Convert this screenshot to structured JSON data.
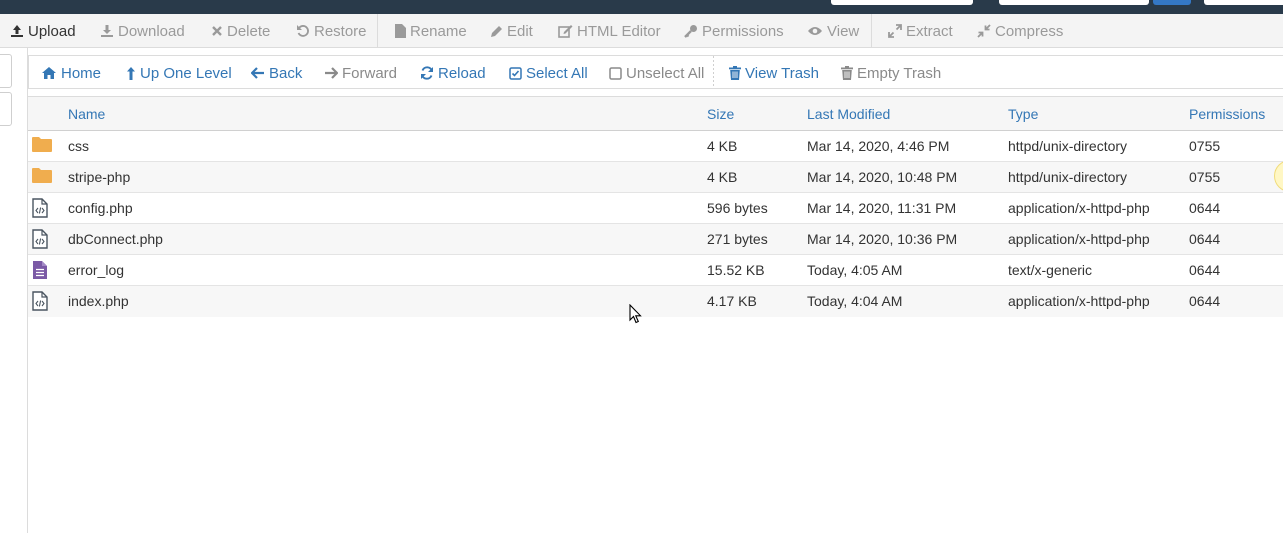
{
  "toolbar": {
    "upload": "Upload",
    "download": "Download",
    "delete": "Delete",
    "restore": "Restore",
    "rename": "Rename",
    "edit": "Edit",
    "html_editor": "HTML Editor",
    "permissions": "Permissions",
    "view": "View",
    "extract": "Extract",
    "compress": "Compress"
  },
  "nav": {
    "home": "Home",
    "up_one_level": "Up One Level",
    "back": "Back",
    "forward": "Forward",
    "reload": "Reload",
    "select_all": "Select All",
    "unselect_all": "Unselect All",
    "view_trash": "View Trash",
    "empty_trash": "Empty Trash"
  },
  "table": {
    "headers": {
      "name": "Name",
      "size": "Size",
      "last_modified": "Last Modified",
      "type": "Type",
      "permissions": "Permissions"
    },
    "rows": [
      {
        "icon": "folder-icon",
        "name": "css",
        "size": "4 KB",
        "modified": "Mar 14, 2020, 4:46 PM",
        "type": "httpd/unix-directory",
        "perms": "0755"
      },
      {
        "icon": "folder-icon",
        "name": "stripe-php",
        "size": "4 KB",
        "modified": "Mar 14, 2020, 10:48 PM",
        "type": "httpd/unix-directory",
        "perms": "0755"
      },
      {
        "icon": "code-file-icon",
        "name": "config.php",
        "size": "596 bytes",
        "modified": "Mar 14, 2020, 11:31 PM",
        "type": "application/x-httpd-php",
        "perms": "0644"
      },
      {
        "icon": "code-file-icon",
        "name": "dbConnect.php",
        "size": "271 bytes",
        "modified": "Mar 14, 2020, 10:36 PM",
        "type": "application/x-httpd-php",
        "perms": "0644"
      },
      {
        "icon": "text-file-icon",
        "name": "error_log",
        "size": "15.52 KB",
        "modified": "Today, 4:05 AM",
        "type": "text/x-generic",
        "perms": "0644"
      },
      {
        "icon": "code-file-icon",
        "name": "index.php",
        "size": "4.17 KB",
        "modified": "Today, 4:04 AM",
        "type": "application/x-httpd-php",
        "perms": "0644"
      }
    ]
  },
  "colors": {
    "link": "#3477b5",
    "disabled": "#9a9a9a",
    "folder": "#f0ad4e",
    "text_file": "#7b5aa6",
    "topbar": "#293a4a"
  }
}
